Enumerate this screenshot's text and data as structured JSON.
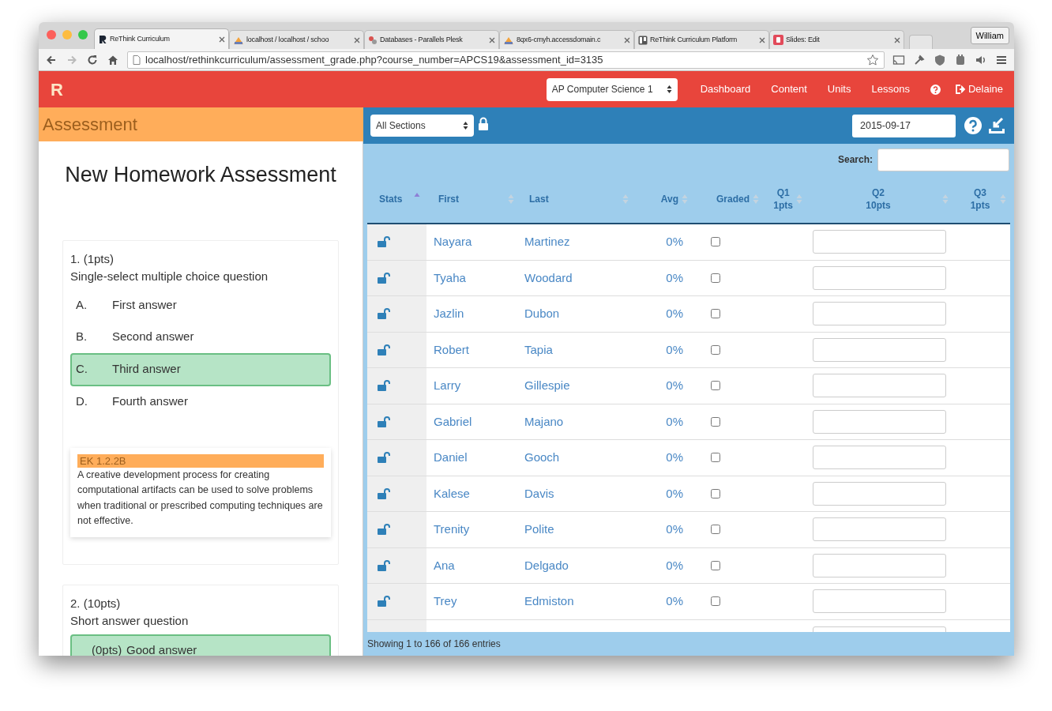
{
  "browser": {
    "tabs": [
      {
        "title": "ReThink Curriculum",
        "selected": true
      },
      {
        "title": "localhost / localhost / schoo",
        "selected": false
      },
      {
        "title": "Databases - Parallels Plesk",
        "selected": false
      },
      {
        "title": "8qx6-cmyh.accessdomain.c",
        "selected": false
      },
      {
        "title": "ReThink Curriculum Platform",
        "selected": false
      },
      {
        "title": "Slides: Edit",
        "selected": false
      }
    ],
    "profile": "William",
    "url": "localhost/rethinkcurriculum/assessment_grade.php?course_number=APCS19&assessment_id=3135"
  },
  "app": {
    "logo": "R",
    "course": "AP Computer Science 1",
    "nav": [
      "Dashboard",
      "Content",
      "Units",
      "Lessons"
    ],
    "user": "Delaine"
  },
  "left": {
    "header": "Assessment",
    "title": "New Homework Assessment",
    "questions": [
      {
        "number": "1. (1pts)",
        "prompt": "Single-select multiple choice question",
        "answers": [
          {
            "label": "A.",
            "text": "First answer",
            "correct": false
          },
          {
            "label": "B.",
            "text": "Second answer",
            "correct": false
          },
          {
            "label": "C.",
            "text": "Third answer",
            "correct": true
          },
          {
            "label": "D.",
            "text": "Fourth answer",
            "correct": false
          }
        ],
        "standard": {
          "code": "EK 1.2.2B",
          "text": "A creative development process for creating computational artifacts can be used to solve problems when traditional or prescribed computing techniques are not effective."
        }
      },
      {
        "number": "2. (10pts)",
        "prompt": "Short answer question",
        "answers": [
          {
            "label": "(0pts)",
            "text": "Good answer",
            "correct": true
          }
        ]
      }
    ]
  },
  "grader": {
    "section": "All Sections",
    "date": "2015-09-17",
    "search_label": "Search:",
    "columns": [
      {
        "label": "Stats",
        "sorted": true
      },
      {
        "label": "First",
        "sorted": false
      },
      {
        "label": "Last",
        "sorted": false
      },
      {
        "label": "Avg",
        "sorted": false
      },
      {
        "label": "Graded",
        "sorted": false
      },
      {
        "label": "Q1",
        "sub": "1pts",
        "sorted": false
      },
      {
        "label": "Q2",
        "sub": "10pts",
        "sorted": false
      },
      {
        "label": "Q3",
        "sub": "1pts",
        "sorted": false
      }
    ],
    "rows": [
      {
        "first": "Nayara",
        "last": "Martinez",
        "avg": "0%",
        "graded": false
      },
      {
        "first": "Tyaha",
        "last": "Woodard",
        "avg": "0%",
        "graded": false
      },
      {
        "first": "Jazlin",
        "last": "Dubon",
        "avg": "0%",
        "graded": false
      },
      {
        "first": "Robert",
        "last": "Tapia",
        "avg": "0%",
        "graded": false
      },
      {
        "first": "Larry",
        "last": "Gillespie",
        "avg": "0%",
        "graded": false
      },
      {
        "first": "Gabriel",
        "last": "Majano",
        "avg": "0%",
        "graded": false
      },
      {
        "first": "Daniel",
        "last": "Gooch",
        "avg": "0%",
        "graded": false
      },
      {
        "first": "Kalese",
        "last": "Davis",
        "avg": "0%",
        "graded": false
      },
      {
        "first": "Trenity",
        "last": "Polite",
        "avg": "0%",
        "graded": false
      },
      {
        "first": "Ana",
        "last": "Delgado",
        "avg": "0%",
        "graded": false
      },
      {
        "first": "Trey",
        "last": "Edmiston",
        "avg": "0%",
        "graded": false
      }
    ],
    "footer": "Showing 1 to 166 of 166 entries"
  }
}
